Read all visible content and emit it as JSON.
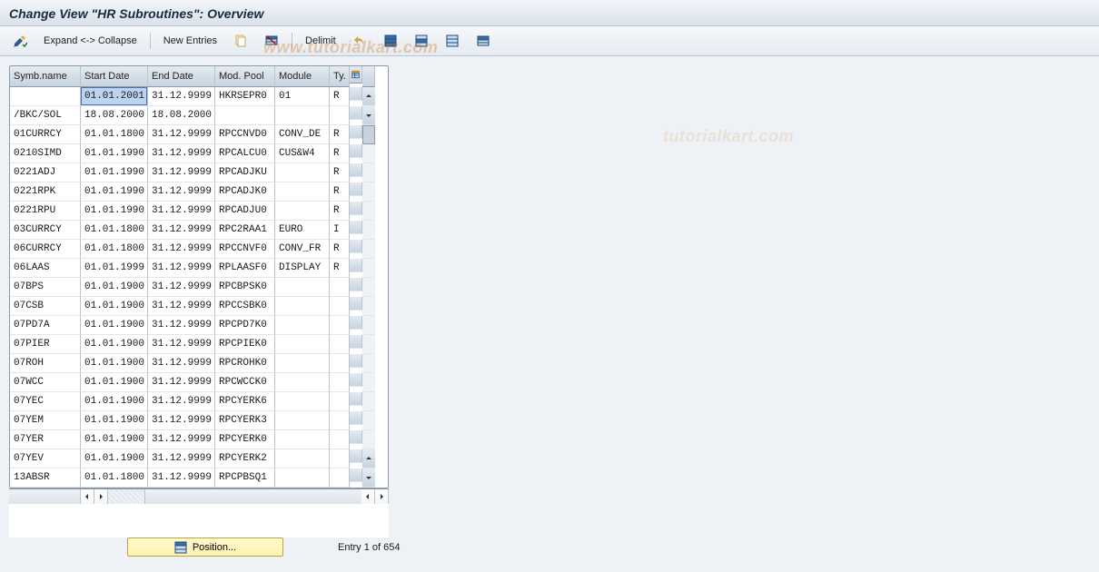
{
  "title": "Change View \"HR Subroutines\": Overview",
  "watermark": "www.tutorialkart.com",
  "watermark2": "tutorialkart.com",
  "toolbar": {
    "expand_collapse": "Expand <-> Collapse",
    "new_entries": "New Entries",
    "delimit": "Delimit",
    "icon_change": "change-icon",
    "icon_copy": "copy-icon",
    "icon_delete": "delete-icon",
    "icon_undo": "undo-icon",
    "icon_select_all": "select-all-icon",
    "icon_deselect_all": "deselect-all-icon",
    "icon_print": "print-icon"
  },
  "grid": {
    "columns": [
      "Symb.name",
      "Start Date",
      "End Date",
      "Mod. Pool",
      "Module",
      "Ty."
    ],
    "config_hint": "Configure columns",
    "rows": [
      {
        "symb": "",
        "start": "01.01.2001",
        "end": "31.12.9999",
        "pool": "HKRSEPR0",
        "module": "01",
        "ty": "R",
        "sel": true
      },
      {
        "symb": "/BKC/SOL",
        "start": "18.08.2000",
        "end": "18.08.2000",
        "pool": "",
        "module": "",
        "ty": ""
      },
      {
        "symb": "01CURRCY",
        "start": "01.01.1800",
        "end": "31.12.9999",
        "pool": "RPCCNVD0",
        "module": "CONV_DE",
        "ty": "R"
      },
      {
        "symb": "0210SIMD",
        "start": "01.01.1990",
        "end": "31.12.9999",
        "pool": "RPCALCU0",
        "module": "CUS&W4",
        "ty": "R"
      },
      {
        "symb": "0221ADJ",
        "start": "01.01.1990",
        "end": "31.12.9999",
        "pool": "RPCADJKU",
        "module": "",
        "ty": "R"
      },
      {
        "symb": "0221RPK",
        "start": "01.01.1990",
        "end": "31.12.9999",
        "pool": "RPCADJK0",
        "module": "",
        "ty": "R"
      },
      {
        "symb": "0221RPU",
        "start": "01.01.1990",
        "end": "31.12.9999",
        "pool": "RPCADJU0",
        "module": "",
        "ty": "R"
      },
      {
        "symb": "03CURRCY",
        "start": "01.01.1800",
        "end": "31.12.9999",
        "pool": "RPC2RAA1",
        "module": "EURO",
        "ty": "I"
      },
      {
        "symb": "06CURRCY",
        "start": "01.01.1800",
        "end": "31.12.9999",
        "pool": "RPCCNVF0",
        "module": "CONV_FR",
        "ty": "R"
      },
      {
        "symb": "06LAAS",
        "start": "01.01.1999",
        "end": "31.12.9999",
        "pool": "RPLAASF0",
        "module": "DISPLAY",
        "ty": "R"
      },
      {
        "symb": "07BPS",
        "start": "01.01.1900",
        "end": "31.12.9999",
        "pool": "RPCBPSK0",
        "module": "",
        "ty": ""
      },
      {
        "symb": "07CSB",
        "start": "01.01.1900",
        "end": "31.12.9999",
        "pool": "RPCCSBK0",
        "module": "",
        "ty": ""
      },
      {
        "symb": "07PD7A",
        "start": "01.01.1900",
        "end": "31.12.9999",
        "pool": "RPCPD7K0",
        "module": "",
        "ty": ""
      },
      {
        "symb": "07PIER",
        "start": "01.01.1900",
        "end": "31.12.9999",
        "pool": "RPCPIEK0",
        "module": "",
        "ty": ""
      },
      {
        "symb": "07ROH",
        "start": "01.01.1900",
        "end": "31.12.9999",
        "pool": "RPCROHK0",
        "module": "",
        "ty": ""
      },
      {
        "symb": "07WCC",
        "start": "01.01.1900",
        "end": "31.12.9999",
        "pool": "RPCWCCK0",
        "module": "",
        "ty": ""
      },
      {
        "symb": "07YEC",
        "start": "01.01.1900",
        "end": "31.12.9999",
        "pool": "RPCYERK6",
        "module": "",
        "ty": ""
      },
      {
        "symb": "07YEM",
        "start": "01.01.1900",
        "end": "31.12.9999",
        "pool": "RPCYERK3",
        "module": "",
        "ty": ""
      },
      {
        "symb": "07YER",
        "start": "01.01.1900",
        "end": "31.12.9999",
        "pool": "RPCYERK0",
        "module": "",
        "ty": ""
      },
      {
        "symb": "07YEV",
        "start": "01.01.1900",
        "end": "31.12.9999",
        "pool": "RPCYERK2",
        "module": "",
        "ty": ""
      },
      {
        "symb": "13ABSR",
        "start": "01.01.1800",
        "end": "31.12.9999",
        "pool": "RPCPBSQ1",
        "module": "",
        "ty": ""
      }
    ]
  },
  "footer": {
    "position_label": "Position...",
    "entry_text": "Entry 1 of 654"
  }
}
